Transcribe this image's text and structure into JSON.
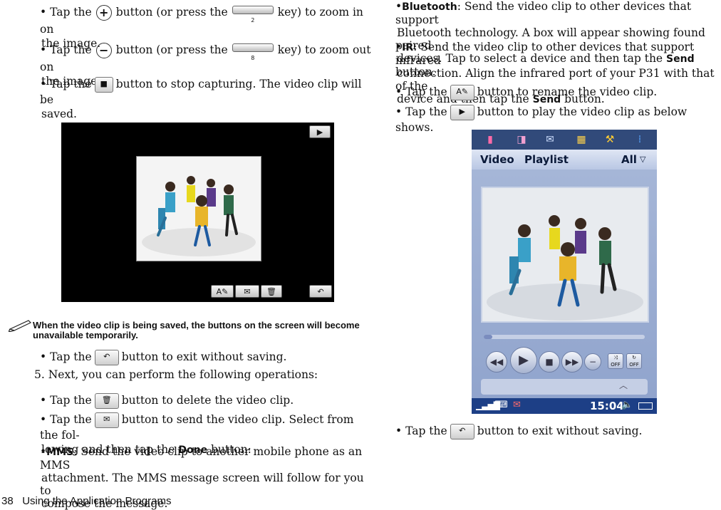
{
  "left": {
    "zoom_in": {
      "pre": "• Tap the",
      "mid": "button (or press the",
      "key": "2",
      "post": "key) to zoom in on",
      "line2": "the image."
    },
    "zoom_out": {
      "pre": "• Tap the",
      "mid": "button (or press the",
      "key": "8",
      "post": "key) to zoom out on",
      "line2": "the image."
    },
    "stop": {
      "pre": "• Tap the",
      "post": "button to stop capturing. The video clip will be",
      "line2": "saved."
    },
    "note": "When the video clip is being saved, the buttons on the screen will become unavailable temporarily.",
    "exit": {
      "pre": "• Tap the",
      "post": "button to exit without saving."
    },
    "step5": "5. Next, you can perform the following operations:",
    "delete": {
      "pre": "• Tap the",
      "post": "button to delete the video clip."
    },
    "send": {
      "pre": "• Tap the",
      "post": "button to send the video clip. Select from the fol-",
      "line2a": "lowing and then tap the",
      "done": "Done",
      "line2b": "button:"
    },
    "mms": {
      "bullet": "•",
      "term": "MMS",
      "text1": ": Send the video clip to another mobile phone as an MMS",
      "text2": "attachment. The MMS message screen will follow for you to",
      "text3": "compose the message."
    }
  },
  "right": {
    "bluetooth": {
      "bullet": "•",
      "term": "Bluetooth",
      "text1": ": Send the video clip to other devices that support",
      "text2": "Bluetooth technology. A box will appear showing found paired",
      "text3a": "devices. Tap to select a device and then tap the",
      "send": "Send",
      "text3b": "button."
    },
    "ir": {
      "bullet": "•",
      "term": "IR",
      "text1": ": Send the video clip to other devices that support infrared",
      "text2": "connection. Align the infrared port of your P31 with that of the",
      "text3a": "device and then tap the",
      "send": "Send",
      "text3b": "button."
    },
    "rename": {
      "pre": "• Tap the",
      "post": "button to rename the video clip."
    },
    "play": {
      "pre": "• Tap the",
      "post": "button to play the video clip as below shows."
    },
    "exit": {
      "pre": "• Tap the",
      "post": "button to exit without saving."
    }
  },
  "phone": {
    "menu_video": "Video",
    "menu_playlist": "Playlist",
    "menu_all": "All",
    "time": "15:04",
    "shuffle_label": "OFF",
    "repeat_label": "OFF"
  },
  "footer": {
    "page": "38",
    "title": "Using the Application Programs"
  },
  "icons": {
    "zoom_in": "zoom-in-icon",
    "zoom_out": "zoom-out-icon",
    "stop": "stop-icon",
    "exit": "return-icon",
    "delete": "trash-icon",
    "send": "envelope-icon",
    "rename": "rename-pen-icon",
    "play": "play-icon"
  }
}
